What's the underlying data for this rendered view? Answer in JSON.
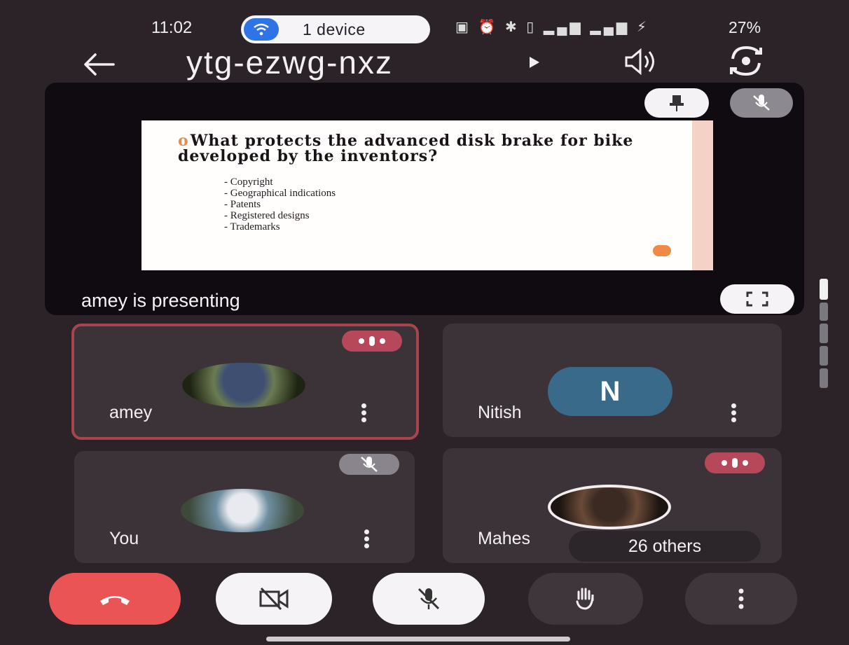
{
  "status_bar": {
    "time": "11:02",
    "cast_label": "1 device",
    "icons": [
      "nfc-icon",
      "alarm-icon",
      "bluetooth-icon",
      "volte-icon",
      "signal-icon",
      "signal-icon",
      "battery-saver-icon"
    ],
    "battery": "27%"
  },
  "header": {
    "meeting_code": "ytg-ezwg-nxz",
    "back_icon": "arrow-left-icon",
    "audio_icon": "speaker-icon",
    "switch_camera_icon": "camera-flip-icon"
  },
  "presentation": {
    "presenter_label": "amey is presenting",
    "pin_icon": "pin-icon",
    "mute_icon": "mic-off-icon",
    "fullscreen_icon": "fullscreen-icon",
    "slide": {
      "question": "What protects the advanced disk brake for bike developed by the inventors?",
      "options": [
        "Copyright",
        "Geographical indications",
        "Patents",
        "Registered designs",
        "Trademarks"
      ]
    }
  },
  "participants": [
    {
      "name": "amey",
      "state": "speaking",
      "avatar": "photo"
    },
    {
      "name": "Nitish",
      "state": "normal",
      "avatar": "N"
    },
    {
      "name": "You",
      "state": "muted",
      "avatar": "photo"
    },
    {
      "name": "Mahes",
      "state": "speaking",
      "avatar": "photo"
    }
  ],
  "others_label": "26 others",
  "controls": {
    "end_call_icon": "phone-hangup-icon",
    "camera_icon": "camera-off-icon",
    "mic_icon": "mic-off-icon",
    "hand_icon": "raise-hand-icon",
    "more_icon": "more-vert-icon"
  },
  "colors": {
    "background": "#2b2327",
    "end_call": "#ea5454",
    "speaking": "#b7485a",
    "accent_blue": "#2f74e6"
  }
}
